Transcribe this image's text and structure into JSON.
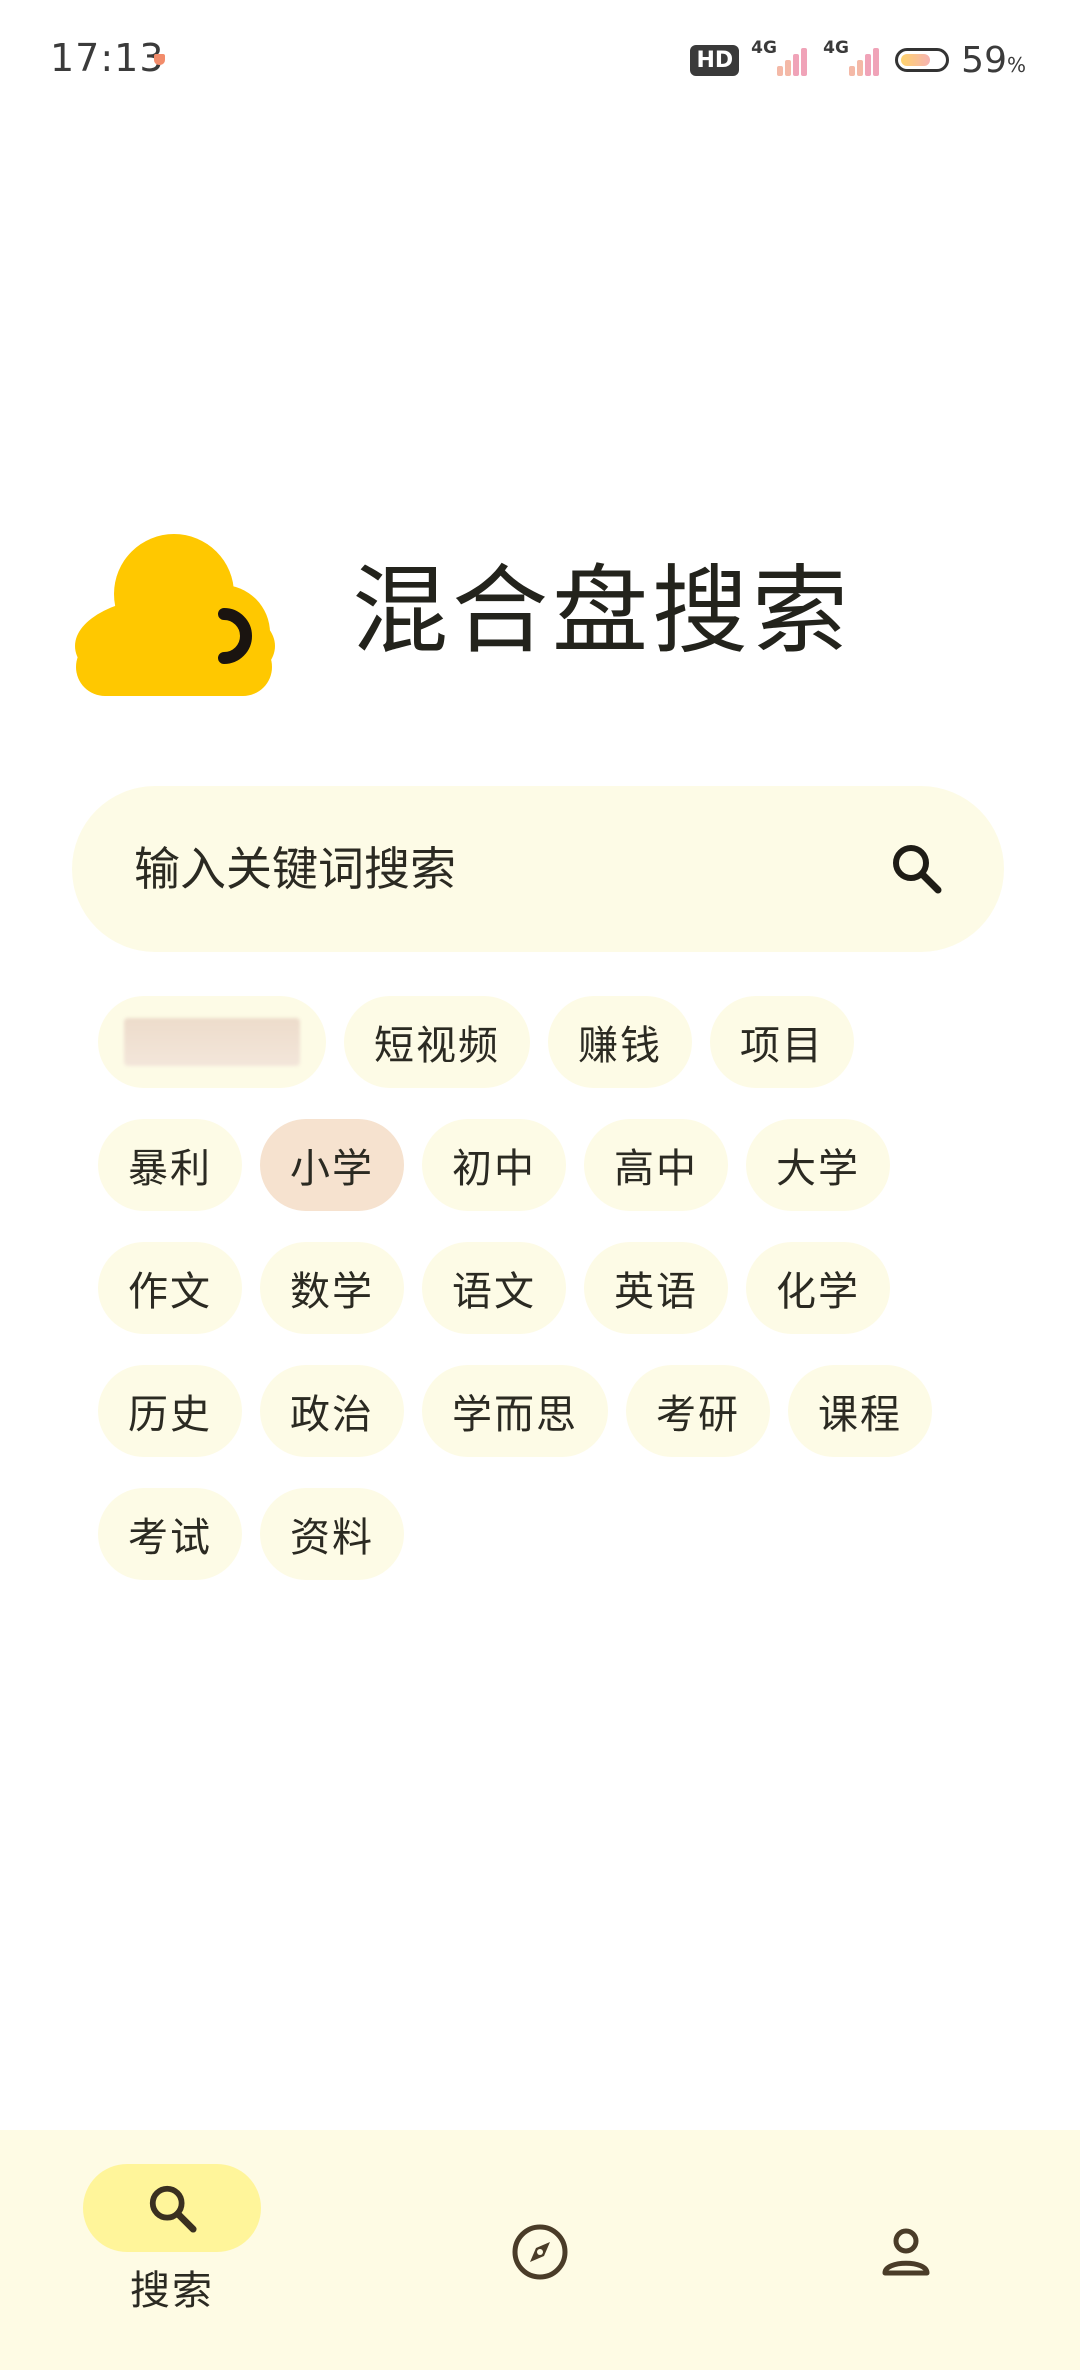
{
  "status_bar": {
    "time": "17:13",
    "hd_label": "HD",
    "network_1": "4G",
    "network_2": "4G",
    "battery_percent": "59",
    "battery_unit": "%"
  },
  "app": {
    "title": "混合盘搜索"
  },
  "search": {
    "placeholder": "输入关键词搜索",
    "value": ""
  },
  "chips": {
    "rows": [
      [
        "",
        "短视频",
        "赚钱",
        "项目"
      ],
      [
        "暴利",
        "小学",
        "初中",
        "高中",
        "大学"
      ],
      [
        "作文",
        "数学",
        "语文",
        "英语",
        "化学"
      ],
      [
        "历史",
        "政治",
        "学而思",
        "考研",
        "课程"
      ],
      [
        "考试",
        "资料"
      ]
    ],
    "selected": "小学"
  },
  "bottom_nav": {
    "search_label": "搜索",
    "active": "search"
  },
  "colors": {
    "accent_yellow": "#ffcc00",
    "chip_bg": "#fdfbe6",
    "chip_selected_bg": "#f6e2cf",
    "nav_bg": "#fefbe4",
    "nav_active_pill": "#fff59a",
    "text_dark": "#2b2a22"
  },
  "icons": {
    "logo": "yellow-cloud-logo",
    "search": "search-icon",
    "discover": "compass-icon",
    "profile": "person-icon"
  }
}
